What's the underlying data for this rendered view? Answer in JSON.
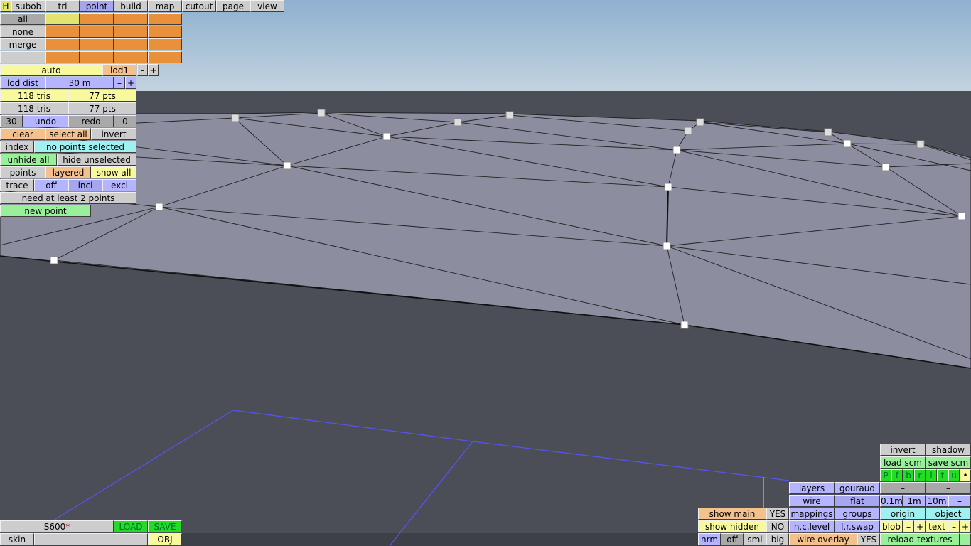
{
  "menu": {
    "h_label": "H",
    "tabs": [
      "subob",
      "tri",
      "point",
      "build",
      "map",
      "cutout",
      "page",
      "view"
    ],
    "active_tab": "point"
  },
  "select": {
    "all": "all",
    "none": "none",
    "merge": "merge",
    "dash": "–"
  },
  "lod": {
    "auto": "auto",
    "level": "lod1",
    "minus": "–",
    "plus": "+",
    "dist_label": "lod dist",
    "dist_value": "30 m"
  },
  "stats": {
    "tris_a": "118 tris",
    "pts_a": "77 pts",
    "tris_b": "118 tris",
    "pts_b": "77 pts"
  },
  "history": {
    "undo_count": "30",
    "undo": "undo",
    "redo": "redo",
    "redo_count": "0"
  },
  "actions": {
    "clear": "clear",
    "select_all": "select all",
    "invert": "invert",
    "index": "index",
    "selection_status": "no points selected",
    "unhide_all": "unhide all",
    "hide_unselected": "hide unselected",
    "points": "points",
    "layered": "layered",
    "show_all": "show all",
    "trace": "trace",
    "off": "off",
    "incl": "incl",
    "excl": "excl",
    "hint": "need at least 2 points",
    "new_point": "new point"
  },
  "file": {
    "name": "S600",
    "modified_mark": "*",
    "load": "LOAD",
    "save": "SAVE",
    "skin": "skin",
    "field": "",
    "obj": "OBJ"
  },
  "view_panel": {
    "show_main": "show main",
    "show_main_value": "YES",
    "show_hidden": "show hidden",
    "show_hidden_value": "NO",
    "nrm": "nrm",
    "off": "off",
    "sml": "sml",
    "big": "big",
    "wire_overlay": "wire overlay",
    "wire_overlay_value": "YES",
    "layers": "layers",
    "gouraud": "gouraud",
    "wire": "wire",
    "flat": "flat",
    "mappings": "mappings",
    "groups": "groups",
    "nc_level": "n.c.level",
    "lr_swap": "l.r.swap"
  },
  "render_panel": {
    "invert": "invert",
    "shadow": "shadow",
    "load_scm": "load scm",
    "save_scm": "save scm",
    "letters": [
      "P",
      "f",
      "b",
      "r",
      "l",
      "t",
      "u",
      "•"
    ],
    "dash1": "–",
    "dash2": "–",
    "grid1": "0.1m",
    "grid2": "1m",
    "grid3": "10m",
    "grid_minus": "–",
    "origin": "origin",
    "object": "object",
    "blob": "blob",
    "blob_minus": "–",
    "blob_plus": "+",
    "text": "text",
    "text_minus": "–",
    "text_plus": "+",
    "reload_textures": "reload textures",
    "reload_minus": "–"
  },
  "colors": {
    "sky_top": "#8fb0d0",
    "sky_bottom": "#c3d3df",
    "ground": "#4b4e57",
    "mesh": "#8c8ea0",
    "guide_line": "#5555ee"
  }
}
